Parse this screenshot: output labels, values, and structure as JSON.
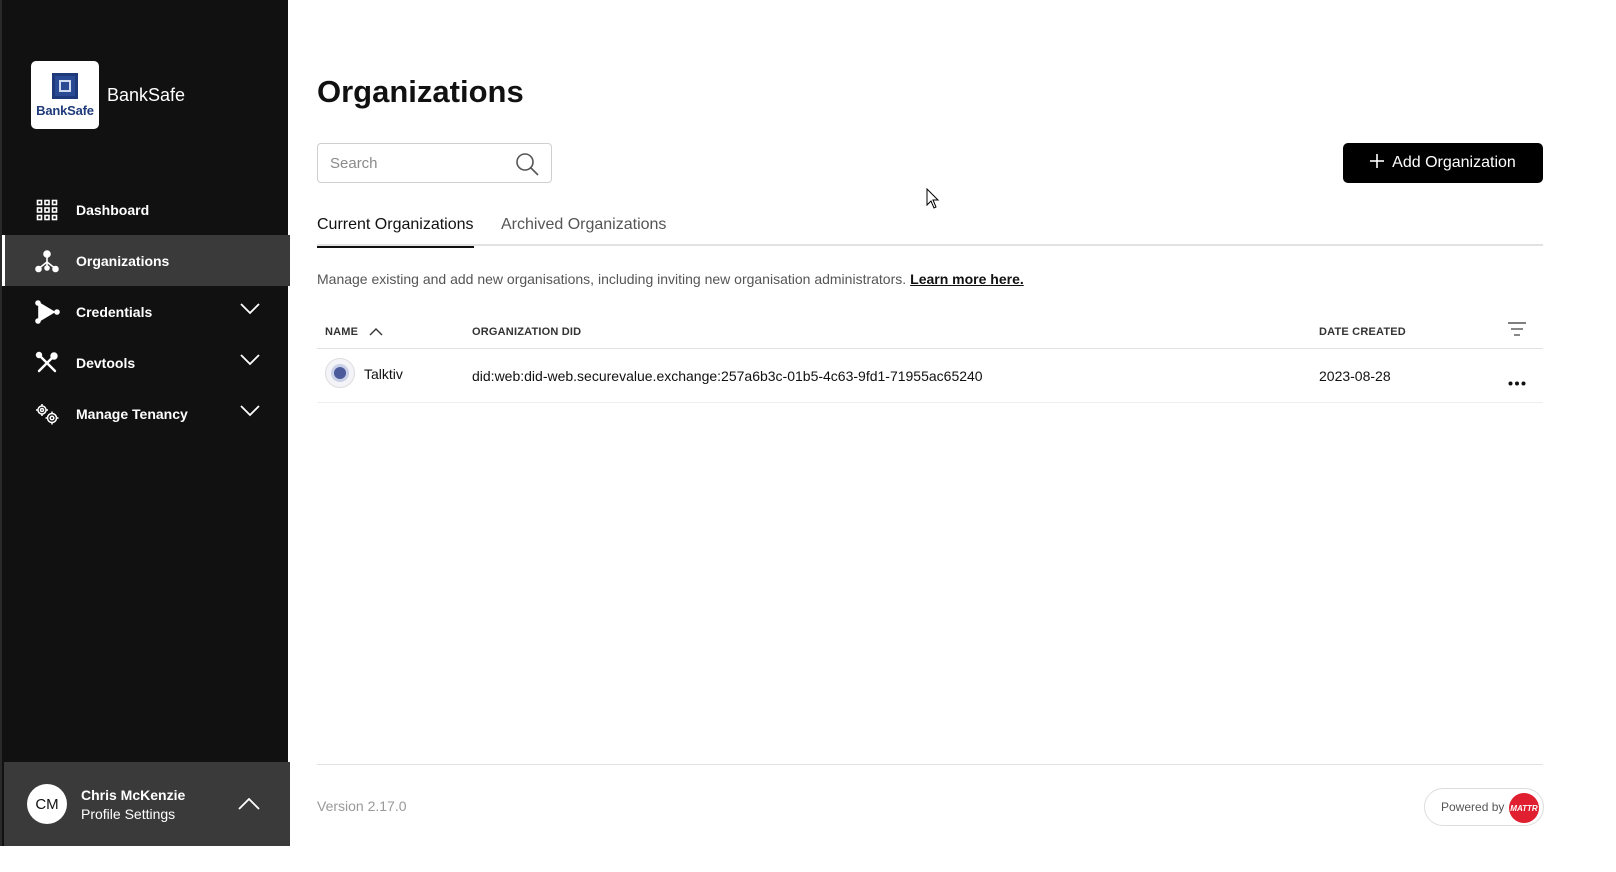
{
  "brand": {
    "logo_text": "BankSafe",
    "name": "BankSafe"
  },
  "nav": {
    "items": [
      {
        "label": "Dashboard",
        "icon": "grid-icon"
      },
      {
        "label": "Organizations",
        "icon": "organization-icon",
        "active": true
      },
      {
        "label": "Credentials",
        "icon": "credential-icon"
      },
      {
        "label": "Devtools",
        "icon": "tools-icon"
      },
      {
        "label": "Manage Tenancy",
        "icon": "settings-icon"
      }
    ]
  },
  "profile": {
    "initials": "CM",
    "name": "Chris McKenzie",
    "subtitle": "Profile Settings"
  },
  "page": {
    "title": "Organizations"
  },
  "search": {
    "placeholder": "Search",
    "value": ""
  },
  "actions": {
    "add_label": "Add Organization"
  },
  "tabs": [
    {
      "label": "Current Organizations",
      "active": true
    },
    {
      "label": "Archived Organizations",
      "active": false
    }
  ],
  "description": {
    "text": "Manage existing and add new organisations, including inviting new organisation administrators.",
    "link": "Learn more here."
  },
  "table": {
    "headers": {
      "name": "NAME",
      "did": "ORGANIZATION DID",
      "date": "DATE CREATED"
    },
    "rows": [
      {
        "name": "Talktiv",
        "did": "did:web:did-web.securevalue.exchange:257a6b3c-01b5-4c63-9fd1-71955ac65240",
        "date": "2023-08-28"
      }
    ]
  },
  "footer": {
    "version": "Version 2.17.0",
    "powered_by": "Powered by",
    "powered_mark": "MATTR"
  },
  "colors": {
    "sidebar_bg": "#111111",
    "active_bg": "#3a3a3a",
    "primary_btn": "#000000",
    "accent_red": "#e02030"
  }
}
